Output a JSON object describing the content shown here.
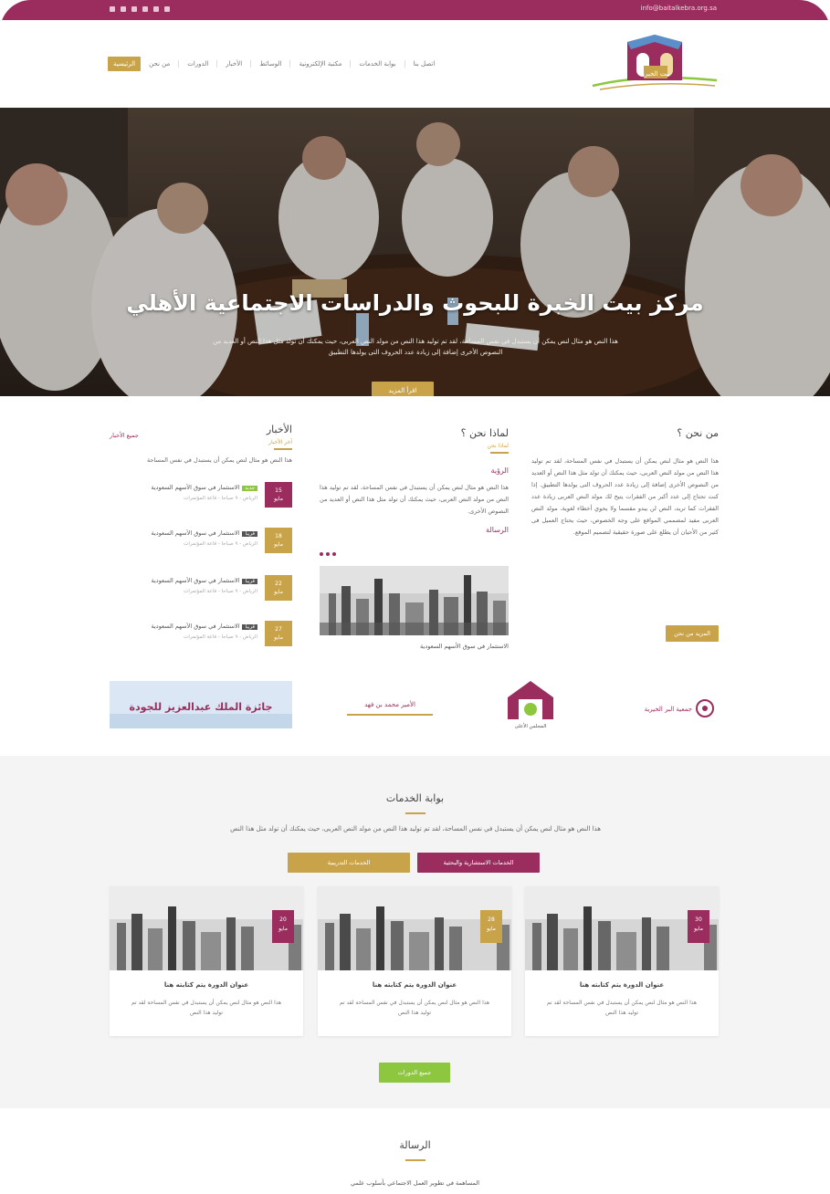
{
  "topbar": {
    "email": "info@baitalkebra.org.sa",
    "social_icons": [
      "facebook-icon",
      "twitter-icon",
      "youtube-icon",
      "instagram-icon",
      "linkedin-icon",
      "email-icon"
    ],
    "colors": {
      "bar": "#9b2d5e"
    }
  },
  "header": {
    "logo_text": "بيت الخبرة",
    "nav": [
      "الرئيسية",
      "من نحن",
      "الدورات",
      "الأخبار",
      "الوسائط",
      "مكتبة الإلكترونية",
      "بوابة الخدمات",
      "اتصل بنا"
    ]
  },
  "hero": {
    "title": "مركز بيت الخبرة للبحوث والدراسات الاجتماعية الأهلي",
    "subtitle": "هذا النص هو مثال لنص يمكن أن يستبدل في نفس المساحة، لقد تم توليد هذا النص من مولد النص العربى، حيث يمكنك أن تولد مثل هذا النص أو العديد من النصوص الأخرى إضافة إلى زيادة عدد الحروف التى يولدها التطبيق",
    "button": "اقرأ المزيد"
  },
  "about": {
    "title": "من نحن ؟",
    "text": "هذا النص هو مثال لنص يمكن أن يستبدل في نفس المساحة، لقد تم توليد هذا النص من مولد النص العربى، حيث يمكنك أن تولد مثل هذا النص أو العديد من النصوص الأخرى إضافة إلى زيادة عدد الحروف التى يولدها التطبيق. إذا كنت تحتاج إلى عدد أكبر من الفقرات يتيح لك مولد النص العربى زيادة عدد الفقرات كما تريد، النص لن يبدو مقسما ولا يحوي أخطاء لغوية، مولد النص العربى مفيد لمصممي المواقع على وجه الخصوص، حيث يحتاج العميل فى كثير من الأحيان أن يطلع على صورة حقيقية لتصميم الموقع.",
    "button": "المزيد من نحن"
  },
  "why": {
    "title": "لماذا نحن ؟",
    "subtitle": "لماذا نحن",
    "vision_title": "الرؤية",
    "vision_text": "هذا النص هو مثال لنص يمكن أن يستبدل في نفس المساحة، لقد تم توليد هذا النص من مولد النص العربى، حيث يمكنك أن تولد مثل هذا النص أو العديد من النصوص الأخرى.",
    "message_title": "الرسالة",
    "news_caption": "الاستثمار في سوق الأسهم السعودية"
  },
  "events": {
    "title": "الأخبار",
    "subtitle": "آخر الأخبار",
    "more": "جميع الأخبار",
    "desc": "هذا النص هو مثال لنص يمكن أن يستبدل في نفس المساحة",
    "items": [
      {
        "day": "15",
        "month": "مايو",
        "tag": "جديد",
        "title": "الاستثمار في سوق الأسهم السعودية",
        "meta": "الرياض - ٩ صباحا - قاعة المؤتمرات",
        "color": "#9b2d5e",
        "tag_color": "#8dc63f"
      },
      {
        "day": "18",
        "month": "مايو",
        "tag": "قريبا",
        "title": "الاستثمار في سوق الأسهم السعودية",
        "meta": "الرياض - ٩ صباحا - قاعة المؤتمرات",
        "color": "#c9a34a",
        "tag_color": "#555555"
      },
      {
        "day": "22",
        "month": "مايو",
        "tag": "قريبا",
        "title": "الاستثمار في سوق الأسهم السعودية",
        "meta": "الرياض - ٩ صباحا - قاعة المؤتمرات",
        "color": "#c9a34a",
        "tag_color": "#555555"
      },
      {
        "day": "27",
        "month": "مايو",
        "tag": "قريبا",
        "title": "الاستثمار في سوق الأسهم السعودية",
        "meta": "الرياض - ٩ صباحا - قاعة المؤتمرات",
        "color": "#c9a34a",
        "tag_color": "#555555"
      }
    ]
  },
  "partners": {
    "items": [
      "جمعية البر الخيرية",
      "المجلس الأعلى",
      "الأمير محمد بن فهد",
      "جائزة الملك عبدالعزيز للجودة"
    ]
  },
  "services": {
    "title": "بوابة الخدمات",
    "desc": "هذا النص هو مثال لنص يمكن أن يستبدل في نفس المساحة، لقد تم توليد هذا النص من مولد النص العربى، حيث يمكنك أن تولد مثل هذا النص",
    "tab_primary": "الخدمات الاستشارية والبحثية",
    "tab_secondary": "الخدمات التدريبية",
    "cards": [
      {
        "day": "30",
        "month": "مايو",
        "title": "عنوان الدورة يتم كتابته هنا",
        "text": "هذا النص هو مثال لنص يمكن أن يستبدل في نفس المساحة لقد تم توليد هذا النص",
        "color": "#9b2d5e"
      },
      {
        "day": "28",
        "month": "مايو",
        "title": "عنوان الدورة يتم كتابته هنا",
        "text": "هذا النص هو مثال لنص يمكن أن يستبدل في نفس المساحة لقد تم توليد هذا النص",
        "color": "#c9a34a"
      },
      {
        "day": "20",
        "month": "مايو",
        "title": "عنوان الدورة يتم كتابته هنا",
        "text": "هذا النص هو مثال لنص يمكن أن يستبدل في نفس المساحة لقد تم توليد هذا النص",
        "color": "#9b2d5e"
      }
    ],
    "more": "جميع الدورات"
  },
  "message": {
    "title": "الرسالة",
    "text": "المساهمة في تطوير العمل الاجتماعي بأسلوب علمي"
  }
}
